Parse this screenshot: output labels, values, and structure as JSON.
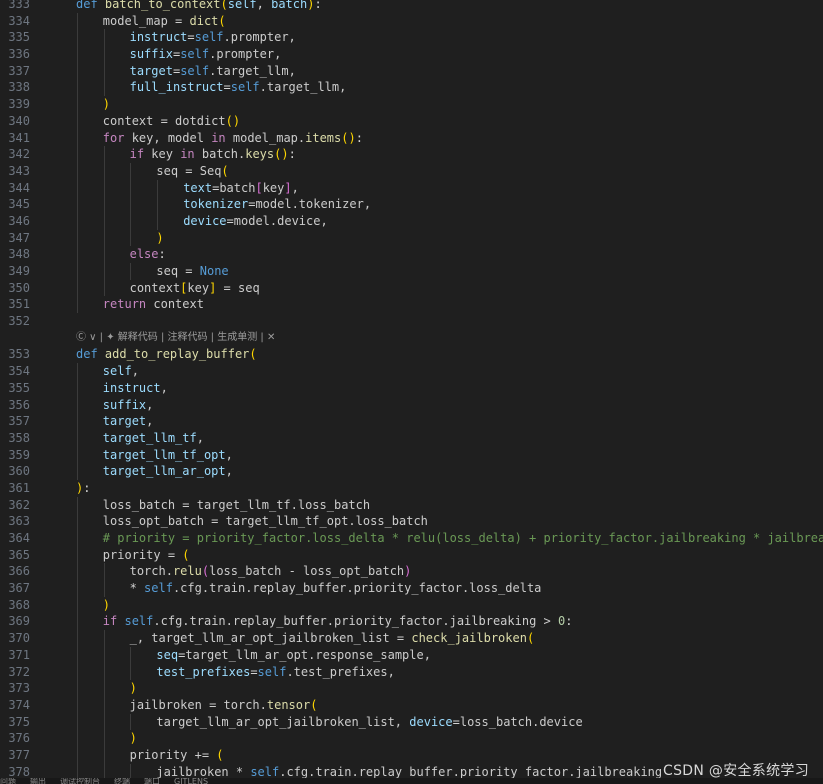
{
  "editor": {
    "lines": [
      {
        "n": "333",
        "indent": 1,
        "tokens": [
          [
            "kw",
            "def "
          ],
          [
            "fn",
            "batch_to_context"
          ],
          [
            "b1",
            "("
          ],
          [
            "pm",
            "self"
          ],
          [
            "op",
            ", "
          ],
          [
            "pm",
            "batch"
          ],
          [
            "b1",
            ")"
          ],
          [
            "op",
            ":"
          ]
        ]
      },
      {
        "n": "334",
        "indent": 2,
        "tokens": [
          [
            "vr",
            "model_map = "
          ],
          [
            "fn",
            "dict"
          ],
          [
            "b1",
            "("
          ]
        ]
      },
      {
        "n": "335",
        "indent": 3,
        "tokens": [
          [
            "pm",
            "instruct"
          ],
          [
            "op",
            "="
          ],
          [
            "kw",
            "self"
          ],
          [
            "vr",
            ".prompter,"
          ]
        ]
      },
      {
        "n": "336",
        "indent": 3,
        "tokens": [
          [
            "pm",
            "suffix"
          ],
          [
            "op",
            "="
          ],
          [
            "kw",
            "self"
          ],
          [
            "vr",
            ".prompter,"
          ]
        ]
      },
      {
        "n": "337",
        "indent": 3,
        "tokens": [
          [
            "pm",
            "target"
          ],
          [
            "op",
            "="
          ],
          [
            "kw",
            "self"
          ],
          [
            "vr",
            ".target_llm,"
          ]
        ]
      },
      {
        "n": "338",
        "indent": 3,
        "tokens": [
          [
            "pm",
            "full_instruct"
          ],
          [
            "op",
            "="
          ],
          [
            "kw",
            "self"
          ],
          [
            "vr",
            ".target_llm,"
          ]
        ]
      },
      {
        "n": "339",
        "indent": 2,
        "tokens": [
          [
            "b1",
            ")"
          ]
        ]
      },
      {
        "n": "340",
        "indent": 2,
        "tokens": [
          [
            "vr",
            "context = "
          ],
          [
            "vr",
            "dotdict"
          ],
          [
            "b1",
            "()"
          ]
        ]
      },
      {
        "n": "341",
        "indent": 2,
        "tokens": [
          [
            "ctl",
            "for "
          ],
          [
            "vr",
            "key, model "
          ],
          [
            "ctl",
            "in "
          ],
          [
            "vr",
            "model_map."
          ],
          [
            "fn",
            "items"
          ],
          [
            "b1",
            "()"
          ],
          [
            "op",
            ":"
          ]
        ]
      },
      {
        "n": "342",
        "indent": 3,
        "tokens": [
          [
            "ctl",
            "if "
          ],
          [
            "vr",
            "key "
          ],
          [
            "ctl",
            "in "
          ],
          [
            "vr",
            "batch."
          ],
          [
            "fn",
            "keys"
          ],
          [
            "b1",
            "()"
          ],
          [
            "op",
            ":"
          ]
        ]
      },
      {
        "n": "343",
        "indent": 4,
        "tokens": [
          [
            "vr",
            "seq = Seq"
          ],
          [
            "b1",
            "("
          ]
        ]
      },
      {
        "n": "344",
        "indent": 5,
        "tokens": [
          [
            "pm",
            "text"
          ],
          [
            "op",
            "="
          ],
          [
            "vr",
            "batch"
          ],
          [
            "b2",
            "["
          ],
          [
            "vr",
            "key"
          ],
          [
            "b2",
            "]"
          ],
          [
            "vr",
            ","
          ]
        ]
      },
      {
        "n": "345",
        "indent": 5,
        "tokens": [
          [
            "pm",
            "tokenizer"
          ],
          [
            "op",
            "="
          ],
          [
            "vr",
            "model.tokenizer,"
          ]
        ]
      },
      {
        "n": "346",
        "indent": 5,
        "tokens": [
          [
            "pm",
            "device"
          ],
          [
            "op",
            "="
          ],
          [
            "vr",
            "model.device,"
          ]
        ]
      },
      {
        "n": "347",
        "indent": 4,
        "tokens": [
          [
            "b1",
            ")"
          ]
        ]
      },
      {
        "n": "348",
        "indent": 3,
        "tokens": [
          [
            "ctl",
            "else"
          ],
          [
            "op",
            ":"
          ]
        ]
      },
      {
        "n": "349",
        "indent": 4,
        "tokens": [
          [
            "vr",
            "seq = "
          ],
          [
            "kw",
            "None"
          ]
        ]
      },
      {
        "n": "350",
        "indent": 3,
        "tokens": [
          [
            "vr",
            "context"
          ],
          [
            "b1",
            "["
          ],
          [
            "vr",
            "key"
          ],
          [
            "b1",
            "]"
          ],
          [
            "vr",
            " = seq"
          ]
        ]
      },
      {
        "n": "351",
        "indent": 2,
        "tokens": [
          [
            "ctl",
            "return "
          ],
          [
            "vr",
            "context"
          ]
        ]
      },
      {
        "n": "352",
        "indent": 1,
        "tokens": []
      },
      {
        "lens": true,
        "text": "Ⓒ ∨ | ✦ 解释代码 | 注释代码 | 生成单测 | ✕"
      },
      {
        "n": "353",
        "indent": 1,
        "tokens": [
          [
            "kw",
            "def "
          ],
          [
            "fn",
            "add_to_replay_buffer"
          ],
          [
            "b1",
            "("
          ]
        ]
      },
      {
        "n": "354",
        "indent": 2,
        "tokens": [
          [
            "pm",
            "self"
          ],
          [
            "vr",
            ","
          ]
        ]
      },
      {
        "n": "355",
        "indent": 2,
        "tokens": [
          [
            "pm",
            "instruct"
          ],
          [
            "vr",
            ","
          ]
        ]
      },
      {
        "n": "356",
        "indent": 2,
        "tokens": [
          [
            "pm",
            "suffix"
          ],
          [
            "vr",
            ","
          ]
        ]
      },
      {
        "n": "357",
        "indent": 2,
        "tokens": [
          [
            "pm",
            "target"
          ],
          [
            "vr",
            ","
          ]
        ]
      },
      {
        "n": "358",
        "indent": 2,
        "tokens": [
          [
            "pm",
            "target_llm_tf"
          ],
          [
            "vr",
            ","
          ]
        ]
      },
      {
        "n": "359",
        "indent": 2,
        "tokens": [
          [
            "pm",
            "target_llm_tf_opt"
          ],
          [
            "vr",
            ","
          ]
        ]
      },
      {
        "n": "360",
        "indent": 2,
        "tokens": [
          [
            "pm",
            "target_llm_ar_opt"
          ],
          [
            "vr",
            ","
          ]
        ]
      },
      {
        "n": "361",
        "indent": 1,
        "tokens": [
          [
            "b1",
            ")"
          ],
          [
            "op",
            ":"
          ]
        ]
      },
      {
        "n": "362",
        "indent": 2,
        "tokens": [
          [
            "vr",
            "loss_batch = target_llm_tf.loss_batch"
          ]
        ]
      },
      {
        "n": "363",
        "indent": 2,
        "tokens": [
          [
            "vr",
            "loss_opt_batch = target_llm_tf_opt.loss_batch"
          ]
        ]
      },
      {
        "n": "364",
        "indent": 2,
        "tokens": [
          [
            "cm",
            "# priority = priority_factor.loss_delta * relu(loss_delta) + priority_factor.jailbreaking * jailbreaking"
          ]
        ]
      },
      {
        "n": "365",
        "indent": 2,
        "tokens": [
          [
            "vr",
            "priority = "
          ],
          [
            "b1",
            "("
          ]
        ]
      },
      {
        "n": "366",
        "indent": 3,
        "tokens": [
          [
            "vr",
            "torch."
          ],
          [
            "fn",
            "relu"
          ],
          [
            "b2",
            "("
          ],
          [
            "vr",
            "loss_batch - loss_opt_batch"
          ],
          [
            "b2",
            ")"
          ]
        ]
      },
      {
        "n": "367",
        "indent": 3,
        "tokens": [
          [
            "op",
            "* "
          ],
          [
            "kw",
            "self"
          ],
          [
            "vr",
            ".cfg.train.replay_buffer.priority_factor.loss_delta"
          ]
        ]
      },
      {
        "n": "368",
        "indent": 2,
        "tokens": [
          [
            "b1",
            ")"
          ]
        ]
      },
      {
        "n": "369",
        "indent": 2,
        "tokens": [
          [
            "ctl",
            "if "
          ],
          [
            "kw",
            "self"
          ],
          [
            "vr",
            ".cfg.train.replay_buffer.priority_factor.jailbreaking > "
          ],
          [
            "nm",
            "0"
          ],
          [
            "op",
            ":"
          ]
        ]
      },
      {
        "n": "370",
        "indent": 3,
        "tokens": [
          [
            "vr",
            "_, target_llm_ar_opt_jailbroken_list = "
          ],
          [
            "fn",
            "check_jailbroken"
          ],
          [
            "b1",
            "("
          ]
        ]
      },
      {
        "n": "371",
        "indent": 4,
        "tokens": [
          [
            "pm",
            "seq"
          ],
          [
            "op",
            "="
          ],
          [
            "vr",
            "target_llm_ar_opt.response_sample,"
          ]
        ]
      },
      {
        "n": "372",
        "indent": 4,
        "tokens": [
          [
            "pm",
            "test_prefixes"
          ],
          [
            "op",
            "="
          ],
          [
            "kw",
            "self"
          ],
          [
            "vr",
            ".test_prefixes,"
          ]
        ]
      },
      {
        "n": "373",
        "indent": 3,
        "tokens": [
          [
            "b1",
            ")"
          ]
        ]
      },
      {
        "n": "374",
        "indent": 3,
        "tokens": [
          [
            "vr",
            "jailbroken = torch."
          ],
          [
            "fn",
            "tensor"
          ],
          [
            "b1",
            "("
          ]
        ]
      },
      {
        "n": "375",
        "indent": 4,
        "tokens": [
          [
            "vr",
            "target_llm_ar_opt_jailbroken_list, "
          ],
          [
            "pm",
            "device"
          ],
          [
            "op",
            "="
          ],
          [
            "vr",
            "loss_batch.device"
          ]
        ]
      },
      {
        "n": "376",
        "indent": 3,
        "tokens": [
          [
            "b1",
            ")"
          ]
        ]
      },
      {
        "n": "377",
        "indent": 3,
        "tokens": [
          [
            "vr",
            "priority += "
          ],
          [
            "b1",
            "("
          ]
        ]
      },
      {
        "n": "378",
        "indent": 4,
        "tokens": [
          [
            "vr",
            "jailbroken * "
          ],
          [
            "kw",
            "self"
          ],
          [
            "vr",
            ".cfg.train.replay_buffer.priority_factor.jailbreaking"
          ]
        ]
      }
    ]
  },
  "statusbar": {
    "items": [
      "问题",
      "输出",
      "调试控制台",
      "终端",
      "端口",
      "GITLENS"
    ]
  },
  "watermark": "CSDN @安全系统学习",
  "colors": {
    "background": "#1f1f1f",
    "keyword": "#569cd6",
    "control": "#c586c0",
    "function": "#dcdcaa",
    "parameter": "#9cdcfe",
    "comment": "#6a9955",
    "bracket1": "#ffd700",
    "bracket2": "#da70d6"
  }
}
